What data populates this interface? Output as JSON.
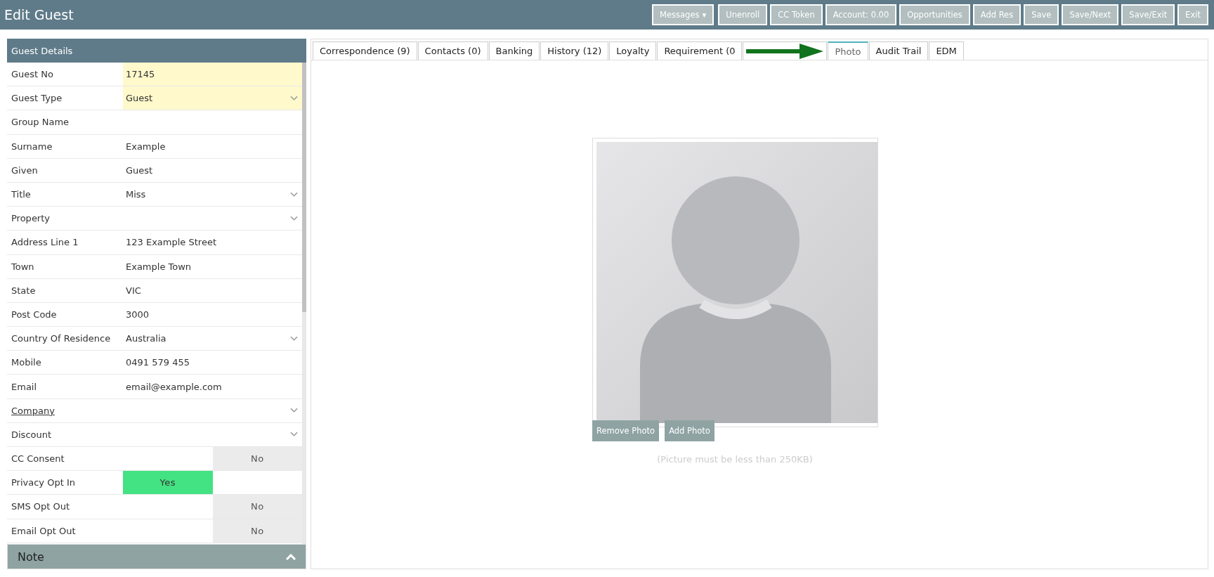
{
  "window": {
    "title": "Edit Guest"
  },
  "toolbar": {
    "messages": {
      "label": "Messages",
      "caret": "▾"
    },
    "buttons": [
      "Unenroll",
      "CC Token",
      "Account: 0.00",
      "Opportunities",
      "Add Res",
      "Save",
      "Save/Next",
      "Save/Exit",
      "Exit"
    ]
  },
  "guest_details": {
    "title": "Guest Details",
    "rows": [
      {
        "label": "Guest No",
        "kind": "text",
        "value": "17145",
        "highlighted": true
      },
      {
        "label": "Guest Type",
        "kind": "select",
        "value": "Guest",
        "highlighted": true
      },
      {
        "label": "Group Name",
        "kind": "text",
        "highlighted": false
      },
      {
        "label": "Surname",
        "kind": "text",
        "value": "Example",
        "highlighted": false
      },
      {
        "label": "Given",
        "kind": "text",
        "value": "Guest",
        "highlighted": false
      },
      {
        "label": "Title",
        "kind": "select",
        "value": "Miss",
        "highlighted": false
      },
      {
        "label": "Property",
        "kind": "select",
        "highlighted": false
      },
      {
        "label": "Address Line 1",
        "kind": "text",
        "value": "123 Example Street",
        "highlighted": false
      },
      {
        "label": "Town",
        "kind": "text",
        "value": "Example Town",
        "highlighted": false
      },
      {
        "label": "State",
        "kind": "text",
        "value": "VIC",
        "highlighted": false
      },
      {
        "label": "Post Code",
        "kind": "text",
        "value": "3000",
        "highlighted": false
      },
      {
        "label": "Country Of Residence",
        "kind": "select",
        "value": "Australia",
        "highlighted": false
      },
      {
        "label": "Mobile",
        "kind": "text",
        "value": "0491 579 455",
        "highlighted": false
      },
      {
        "label": "Email",
        "kind": "text",
        "value": "email@example.com",
        "highlighted": false
      },
      {
        "label": "Company",
        "kind": "link-select",
        "highlighted": false
      },
      {
        "label": "Discount",
        "kind": "select",
        "highlighted": false
      },
      {
        "label": "CC Consent",
        "kind": "toggle",
        "on": false,
        "value": "No"
      },
      {
        "label": "Privacy Opt In",
        "kind": "toggle",
        "on": true,
        "value": "Yes"
      },
      {
        "label": "SMS Opt Out",
        "kind": "toggle",
        "on": false,
        "value": "No"
      },
      {
        "label": "Email Opt Out",
        "kind": "toggle",
        "on": false,
        "value": "No"
      }
    ]
  },
  "note": {
    "title": "Note",
    "expanded": false
  },
  "tabs": [
    {
      "label": "Correspondence (9)",
      "selected": false
    },
    {
      "label": "Contacts (0)",
      "selected": false
    },
    {
      "label": "Banking",
      "selected": false
    },
    {
      "label": "History (12)",
      "selected": false
    },
    {
      "label": "Loyalty",
      "selected": false
    },
    {
      "label": "Requirement (0",
      "selected": false
    },
    {
      "selected": false
    },
    {
      "label": "Photo",
      "selected": true
    },
    {
      "label": "Audit Trail",
      "selected": false
    },
    {
      "label": "EDM",
      "selected": false
    }
  ],
  "photo": {
    "buttons": [
      "Remove Photo",
      "Add Photo"
    ],
    "hint": "(Picture must be less than 250KB)"
  }
}
